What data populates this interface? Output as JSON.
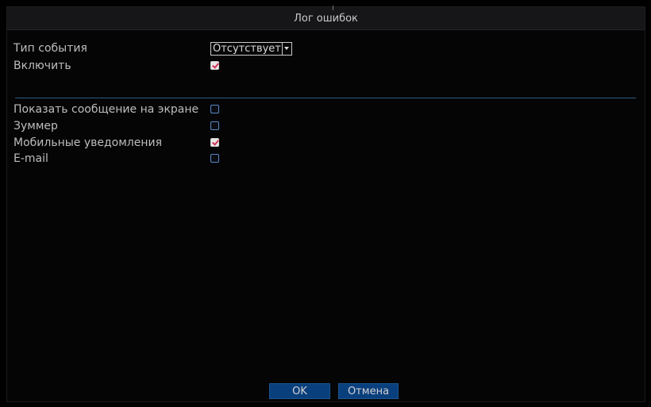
{
  "window": {
    "title": "Лог ошибок"
  },
  "form": {
    "event_type": {
      "label": "Тип события",
      "value": "Отсутствует"
    },
    "enable": {
      "label": "Включить",
      "checked": true
    }
  },
  "actions": {
    "show_message": {
      "label": "Показать сообщение на экране",
      "checked": false
    },
    "buzzer": {
      "label": "Зуммер",
      "checked": false
    },
    "mobile_notifications": {
      "label": "Мобильные уведомления",
      "checked": true
    },
    "email": {
      "label": "E-mail",
      "checked": false
    }
  },
  "buttons": {
    "ok": "OK",
    "cancel": "Отмена"
  },
  "colors": {
    "accent": "#0a3f7d",
    "divider": "#2d5d82",
    "checkbox_border": "#5a87c5",
    "check_mark": "#d6335a"
  }
}
